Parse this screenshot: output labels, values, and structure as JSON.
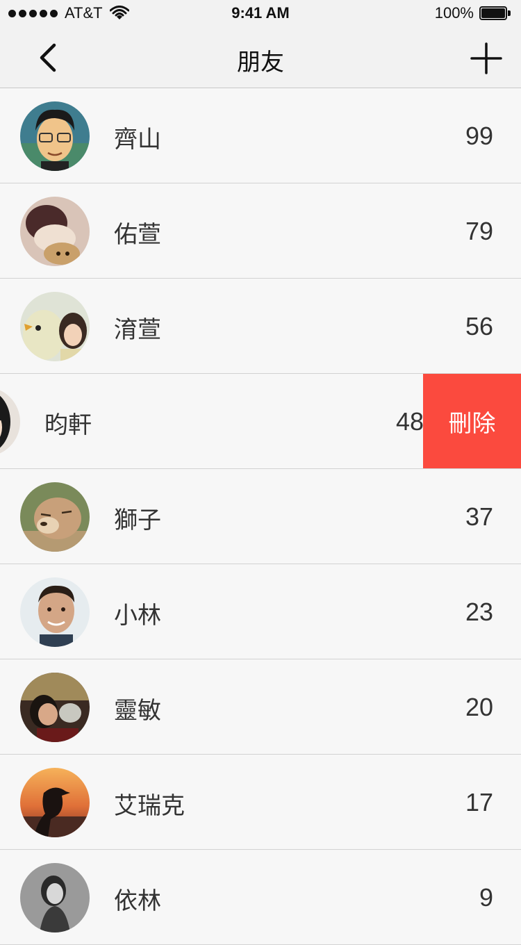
{
  "status_bar": {
    "carrier": "AT&T",
    "time": "9:41 AM",
    "battery": "100%"
  },
  "nav": {
    "title": "朋友",
    "back_icon": "chevron-left-icon",
    "add_icon": "plus-icon"
  },
  "friends": [
    {
      "name": "齊山",
      "count": "99",
      "avatar_color": "#3f7d8f"
    },
    {
      "name": "佑萱",
      "count": "79",
      "avatar_color": "#c9a59a"
    },
    {
      "name": "淯萱",
      "count": "56",
      "avatar_color": "#c7cbb5"
    },
    {
      "name": "昀軒",
      "count": "48",
      "avatar_color": "#2a2a2a",
      "swiped": true,
      "delete_label": "刪除"
    },
    {
      "name": "獅子",
      "count": "37",
      "avatar_color": "#a88466"
    },
    {
      "name": "小林",
      "count": "23",
      "avatar_color": "#d9b39a"
    },
    {
      "name": "靈敏",
      "count": "20",
      "avatar_color": "#6b4a3a"
    },
    {
      "name": "艾瑞克",
      "count": "17",
      "avatar_color": "#e0823e"
    },
    {
      "name": "依林",
      "count": "9",
      "avatar_color": "#8a8a8a"
    }
  ],
  "colors": {
    "delete_red": "#fb4a3e",
    "background": "#f7f7f7",
    "nav_background": "#f2f2f2"
  }
}
